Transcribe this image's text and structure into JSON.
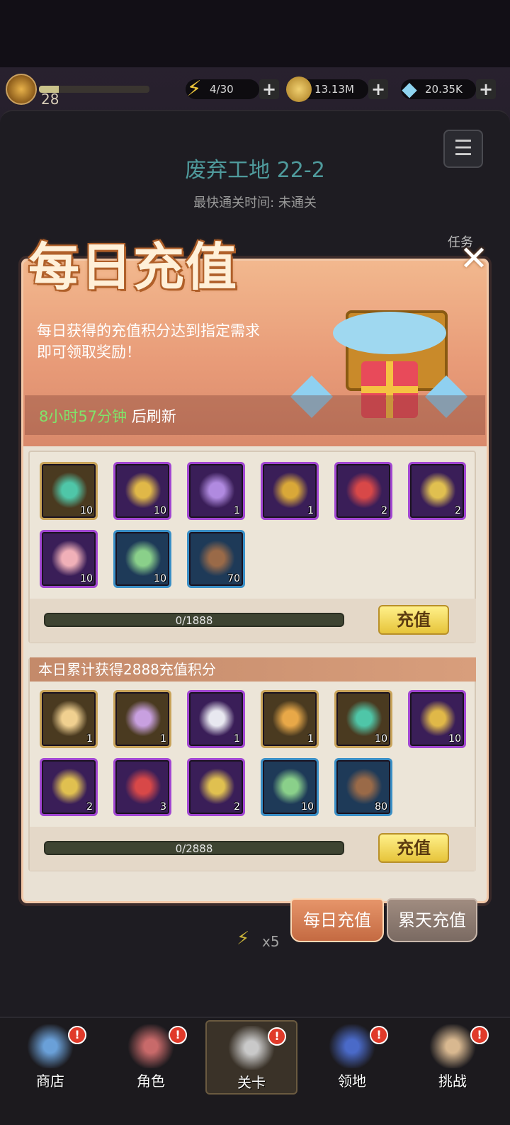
{
  "top": {
    "level": "28",
    "energy": "4/30",
    "gold": "13.13M",
    "gems": "20.35K",
    "plus": "+"
  },
  "stage": {
    "title": "废弃工地 22-2",
    "sub": "最快通关时间:   未通关",
    "task": "任务",
    "energy_cost": "x5"
  },
  "popup": {
    "title": "每日充值",
    "desc_line1": "每日获得的充值积分达到指定需求",
    "desc_line2": "即可领取奖励！",
    "refresh_time": "8小时57分钟",
    "refresh_suffix": " 后刷新",
    "close": "✕"
  },
  "tier1": {
    "items": [
      {
        "icon": "green-crystal-icon",
        "rarity": "gold",
        "count": "10"
      },
      {
        "icon": "gold-key-icon",
        "rarity": "purple",
        "count": "10"
      },
      {
        "icon": "wizard-hat-icon",
        "rarity": "purple",
        "count": "1"
      },
      {
        "icon": "treasure-chest-icon",
        "rarity": "purple",
        "count": "1"
      },
      {
        "icon": "red-potion-icon",
        "rarity": "purple",
        "count": "2"
      },
      {
        "icon": "gold-coin-icon",
        "rarity": "purple",
        "count": "2"
      },
      {
        "icon": "cake-icon",
        "rarity": "purple",
        "count": "10"
      },
      {
        "icon": "gem-pile-icon",
        "rarity": "blue",
        "count": "10"
      },
      {
        "icon": "gem-bag-icon",
        "rarity": "blue",
        "count": "70"
      }
    ],
    "progress": "0/1888",
    "progress_value": 0,
    "button": "充值"
  },
  "tier2": {
    "heading": "本日累计获得2888充值积分",
    "items": [
      {
        "icon": "s-wizard-hat-icon",
        "rarity": "gold",
        "count": "1"
      },
      {
        "icon": "s-treasure-chest-icon",
        "rarity": "gold",
        "count": "1"
      },
      {
        "icon": "ur-hero-icon",
        "rarity": "purple",
        "count": "1"
      },
      {
        "icon": "lantern-icon",
        "rarity": "gold",
        "count": "1"
      },
      {
        "icon": "green-crystal-icon",
        "rarity": "gold",
        "count": "10"
      },
      {
        "icon": "gold-key-icon",
        "rarity": "purple",
        "count": "10"
      },
      {
        "icon": "gold-coin-icon",
        "rarity": "purple",
        "count": "2"
      },
      {
        "icon": "red-potion-icon",
        "rarity": "purple",
        "count": "3"
      },
      {
        "icon": "gold-coin-icon",
        "rarity": "purple",
        "count": "2"
      },
      {
        "icon": "gem-pile-icon",
        "rarity": "blue",
        "count": "10"
      },
      {
        "icon": "gem-bag-icon",
        "rarity": "blue",
        "count": "80"
      }
    ],
    "progress": "0/2888",
    "progress_value": 0,
    "button": "充值"
  },
  "tabs": {
    "daily": "每日充值",
    "cumulative": "累天充值"
  },
  "nav": [
    {
      "label": "商店",
      "icon": "shop-icon",
      "badge": "!"
    },
    {
      "label": "角色",
      "icon": "character-icon",
      "badge": "!"
    },
    {
      "label": "关卡",
      "icon": "crossed-swords-icon",
      "badge": "!"
    },
    {
      "label": "领地",
      "icon": "castle-icon",
      "badge": "!"
    },
    {
      "label": "挑战",
      "icon": "challenge-map-icon",
      "badge": "!"
    }
  ]
}
